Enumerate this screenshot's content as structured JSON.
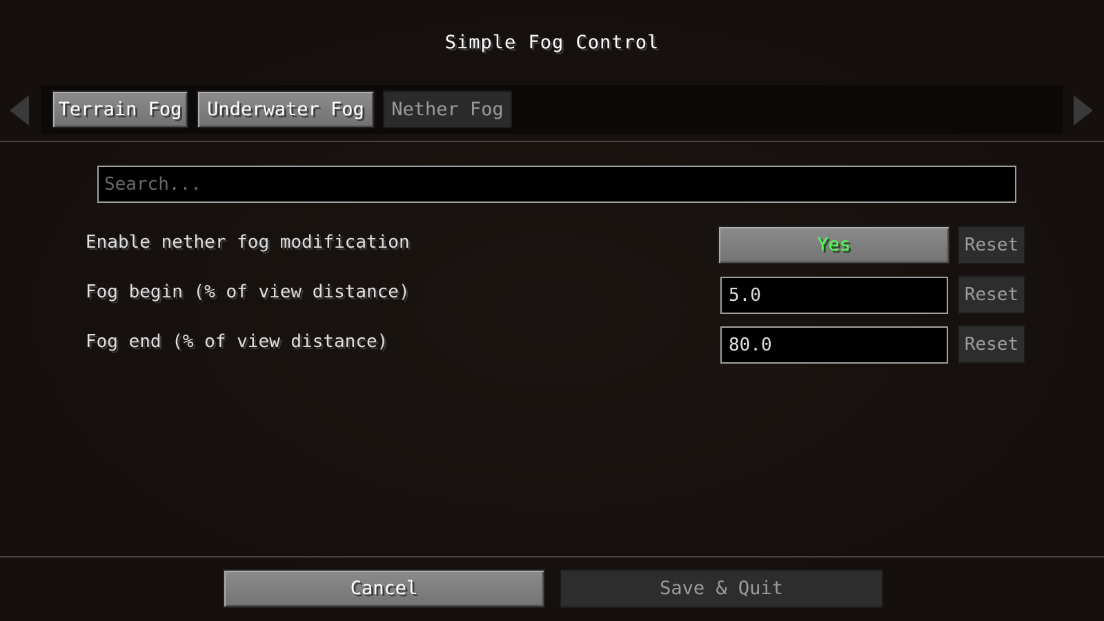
{
  "window": {
    "title": "Simple Fog Control"
  },
  "tabs": [
    {
      "label": "Terrain Fog",
      "state": "enabled"
    },
    {
      "label": "Underwater Fog",
      "state": "enabled"
    },
    {
      "label": "Nether Fog",
      "state": "selected"
    }
  ],
  "search": {
    "placeholder": "Search...",
    "value": ""
  },
  "options": [
    {
      "label": "Enable nether fog modification",
      "type": "toggle",
      "value": "Yes",
      "value_color": "#55ff55",
      "reset_label": "Reset"
    },
    {
      "label": "Fog begin (% of view distance)",
      "type": "number",
      "value": "5.0",
      "reset_label": "Reset"
    },
    {
      "label": "Fog end (% of view distance)",
      "type": "number",
      "value": "80.0",
      "reset_label": "Reset"
    }
  ],
  "footer": {
    "cancel_label": "Cancel",
    "save_label": "Save & Quit"
  },
  "icons": {
    "scroll_left": "arrow-left-icon",
    "scroll_right": "arrow-right-icon"
  }
}
